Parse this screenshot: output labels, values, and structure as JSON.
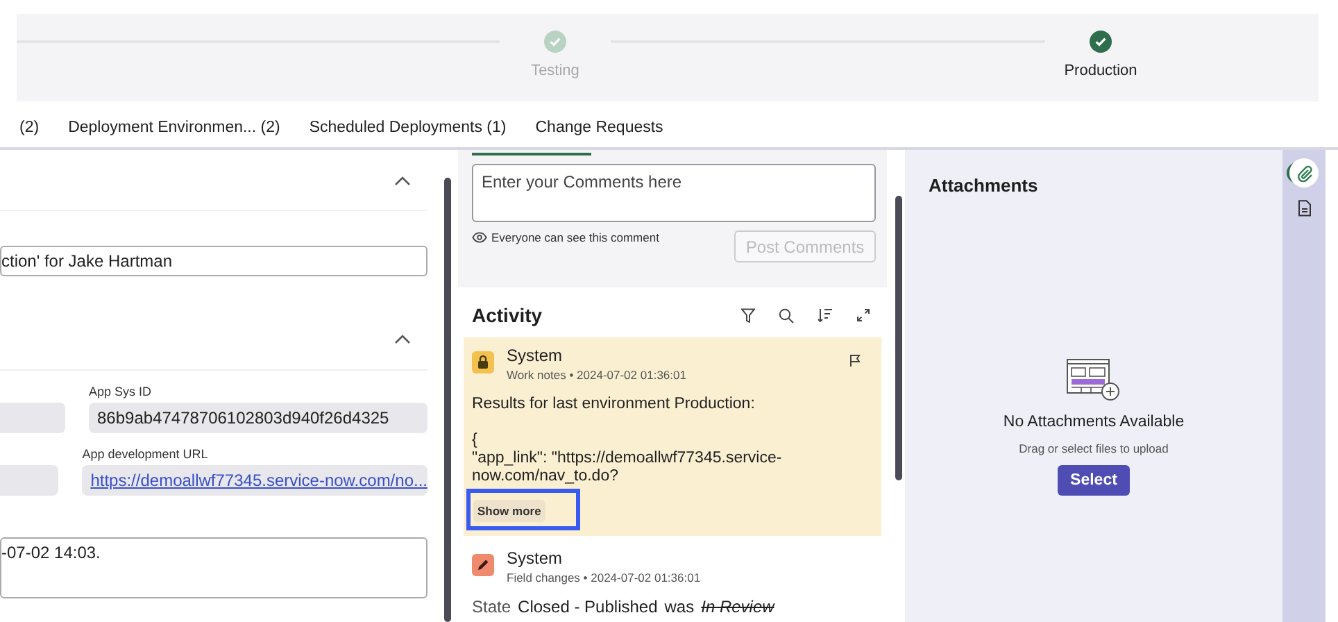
{
  "stepper": {
    "steps": [
      {
        "label": "Testing",
        "current": false
      },
      {
        "label": "Production",
        "current": true
      }
    ]
  },
  "tabs": [
    {
      "label": "(2)",
      "selected": false
    },
    {
      "label": "Deployment Environmen... (2)",
      "selected": false
    },
    {
      "label": "Scheduled Deployments (1)",
      "selected": false
    },
    {
      "label": "Change Requests",
      "selected": false
    }
  ],
  "details": {
    "title_value": "ction' for Jake Hartman",
    "app_fields": [
      {
        "label": "App Sys ID",
        "value": "86b9ab47478706102803d940f26d4325",
        "kind": "text"
      },
      {
        "label": "App development URL",
        "value": "https://demoallwf77345.service-now.com/no...",
        "kind": "link"
      }
    ],
    "description": "-07-02 14:03."
  },
  "comments": {
    "placeholder": "Enter your Comments here",
    "visibility_note": "Everyone can see this comment",
    "post_button": {
      "label": "Post Comments",
      "disabled": true
    }
  },
  "activity": {
    "title": "Activity",
    "entries": [
      {
        "kind": "work_notes",
        "author": "System",
        "meta": "Work notes • 2024-07-02 01:36:01",
        "paragraphs": [
          "Results for last environment Production:",
          "{\n\"app_link\": \"https://demoallwf77345.service-now.com/nav_to.do?"
        ],
        "show_more": {
          "label": "Show more",
          "highlighted": true
        }
      },
      {
        "kind": "field_changes",
        "author": "System",
        "meta": "Field changes • 2024-07-02 01:36:01",
        "changes": [
          {
            "field": "State",
            "value": "Closed - Published",
            "joiner": "was",
            "old_value": "In Review"
          }
        ]
      }
    ]
  },
  "attachments": {
    "title": "Attachments",
    "empty_title": "No Attachments Available",
    "empty_hint": "Drag or select files to upload",
    "select_button": "Select"
  },
  "rail": {
    "items": [
      {
        "kind": "attachment",
        "selected": true
      },
      {
        "kind": "document",
        "selected": false
      }
    ]
  }
}
